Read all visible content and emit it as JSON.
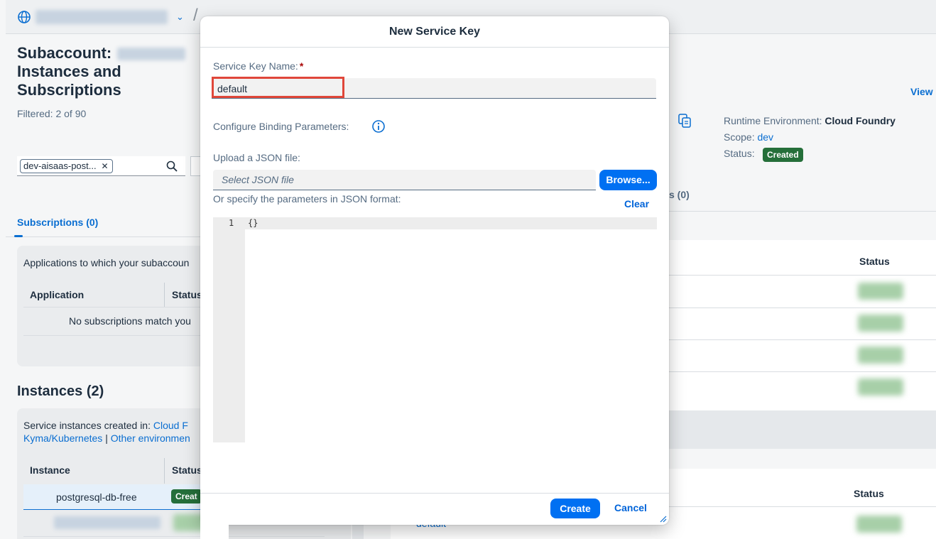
{
  "background": {
    "subaccount_title": "Subaccount:",
    "page_title_line2": "Instances and",
    "page_title_line3": "Subscriptions",
    "filtered": "Filtered: 2 of 90",
    "filter_token": "dev-aisaas-post...",
    "subscriptions_tab": "Subscriptions (0)",
    "applications_desc": "Applications to which your subaccoun",
    "col_application": "Application",
    "col_status": "Status",
    "no_subscriptions": "No subscriptions match you",
    "instances_title": "Instances (2)",
    "service_instances_prefix": "Service instances created in:",
    "cloud_link": "Cloud F",
    "kyma_link": "Kyma/Kubernetes",
    "separator": "|",
    "other_link": "Other environmen",
    "col_instance": "Instance",
    "instance_row_name": "postgresql-db-free",
    "instance_status_badge": "Creat",
    "view_link": "View",
    "runtime_label": "Runtime Environment:",
    "runtime_value": "Cloud Foundry",
    "scope_label": "Scope:",
    "scope_value": "dev",
    "status_label": "Status:",
    "status_value": "Created",
    "tab_partial": "s (0)",
    "right_status_header": "Status",
    "right_status_header2": "Status",
    "default_link": "default"
  },
  "dialog": {
    "title": "New Service Key",
    "service_key_name_label": "Service Key Name:",
    "required_mark": "*",
    "service_key_name_value": "default",
    "configure_label": "Configure Binding Parameters:",
    "upload_label": "Upload a JSON file:",
    "file_placeholder": "Select JSON file",
    "browse_button": "Browse...",
    "specify_label": "Or specify the parameters in JSON format:",
    "clear_button": "Clear",
    "editor_line_number": "1",
    "editor_content": "{}",
    "create_button": "Create",
    "cancel_button": "Cancel"
  },
  "colors": {
    "accent": "#0070f2",
    "link": "#0a6ed1",
    "status_green": "#256f3a",
    "highlight": "#e0473a"
  }
}
